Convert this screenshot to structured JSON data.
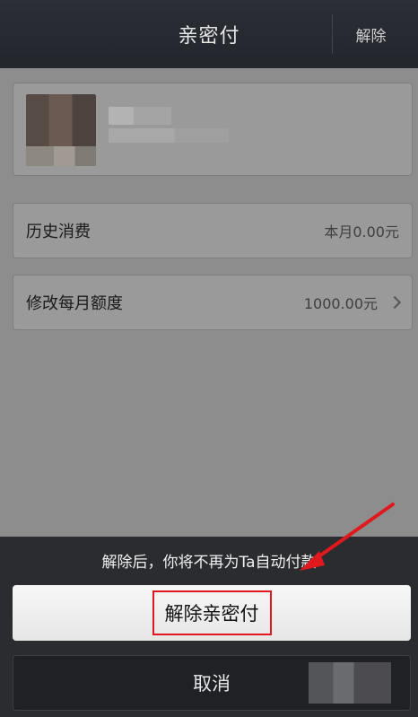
{
  "header": {
    "title": "亲密付",
    "action_label": "解除"
  },
  "history": {
    "label": "历史消费",
    "value": "本月0.00元"
  },
  "limit": {
    "label": "修改每月额度",
    "value": "1000.00元"
  },
  "sheet": {
    "notice": "解除后，你将不再为Ta自动付款",
    "confirm_label": "解除亲密付",
    "cancel_label": "取消"
  },
  "colors": {
    "highlight": "#e0191e",
    "titlebar": "#2b2e35"
  }
}
